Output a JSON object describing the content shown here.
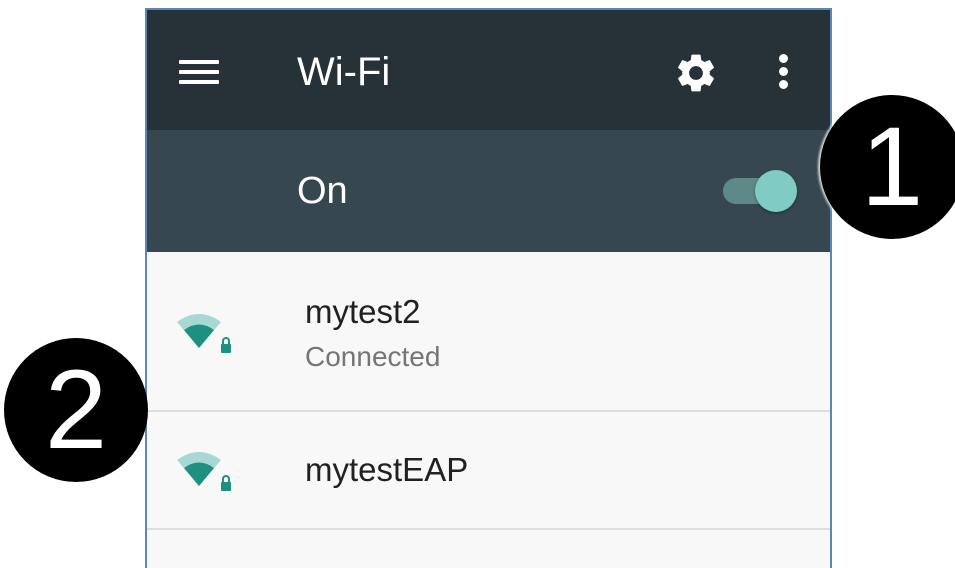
{
  "toolbar": {
    "title": "Wi-Fi",
    "menu_icon": "hamburger-menu-icon",
    "settings_icon": "gear-icon",
    "more_icon": "more-vert-icon",
    "background_color": "#263238"
  },
  "switch_bar": {
    "label": "On",
    "state": true,
    "background_color": "#37474f",
    "accent_color": "#80cbc4"
  },
  "networks": [
    {
      "name": "mytest2",
      "status": "Connected",
      "icon": "wifi-signal-locked-icon"
    },
    {
      "name": "mytestEAP",
      "status": "",
      "icon": "wifi-signal-locked-icon"
    }
  ],
  "callouts": [
    {
      "label": "1"
    },
    {
      "label": "2"
    }
  ]
}
